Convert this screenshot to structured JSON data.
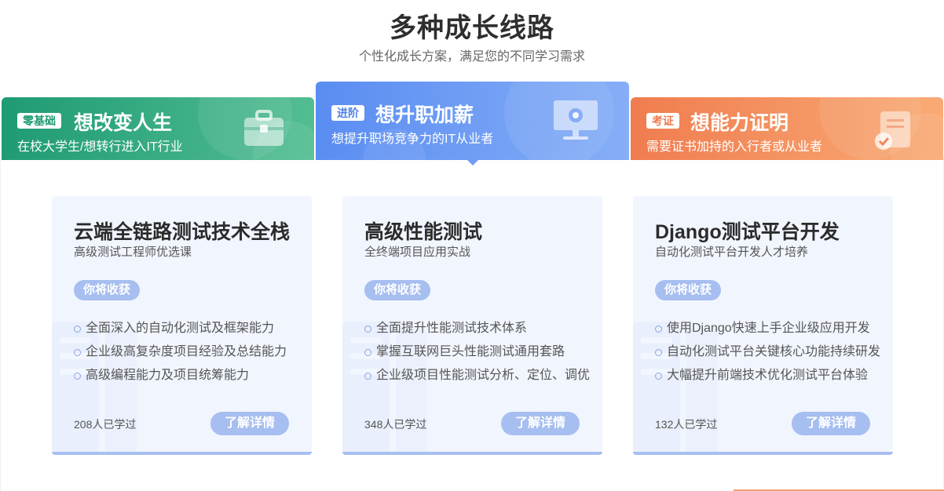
{
  "header": {
    "title": "多种成长线路",
    "subtitle": "个性化成长方案，满足您的不同学习需求"
  },
  "tabs": [
    {
      "badge": "零基础",
      "title": "想改变人生",
      "desc": "在校大学生/想转行进入IT行业",
      "icon": "briefcase-icon",
      "color": "#1f9b74"
    },
    {
      "badge": "进阶",
      "title": "想升职加薪",
      "desc": "想提升职场竞争力的IT从业者",
      "icon": "monitor-gear-icon",
      "color": "#5a8df2",
      "active": true
    },
    {
      "badge": "考证",
      "title": "想能力证明",
      "desc": "需要证书加持的入行者或从业者",
      "icon": "certificate-icon",
      "color": "#f07c4f"
    }
  ],
  "cards": [
    {
      "title": "云端全链路测试技术全栈",
      "subtitle": "高级测试工程师优选课",
      "gain_label": "你将收获",
      "items": [
        "全面深入的自动化测试及框架能力",
        "企业级高复杂度项目经验及总结能力",
        "高级编程能力及项目统筹能力"
      ],
      "learned": "208人已学过",
      "button": "了解详情"
    },
    {
      "title": "高级性能测试",
      "subtitle": "全终端项目应用实战",
      "gain_label": "你将收获",
      "items": [
        "全面提升性能测试技术体系",
        "掌握互联网巨头性能测试通用套路",
        "企业级项目性能测试分析、定位、调优"
      ],
      "learned": "348人已学过",
      "button": "了解详情"
    },
    {
      "title": "Django测试平台开发",
      "subtitle": "自动化测试平台开发人才培养",
      "gain_label": "你将收获",
      "items": [
        "使用Django快速上手企业级应用开发",
        "自动化测试平台关键核心功能持续研发",
        "大幅提升前端技术优化测试平台体验"
      ],
      "learned": "132人已学过",
      "button": "了解详情"
    }
  ]
}
